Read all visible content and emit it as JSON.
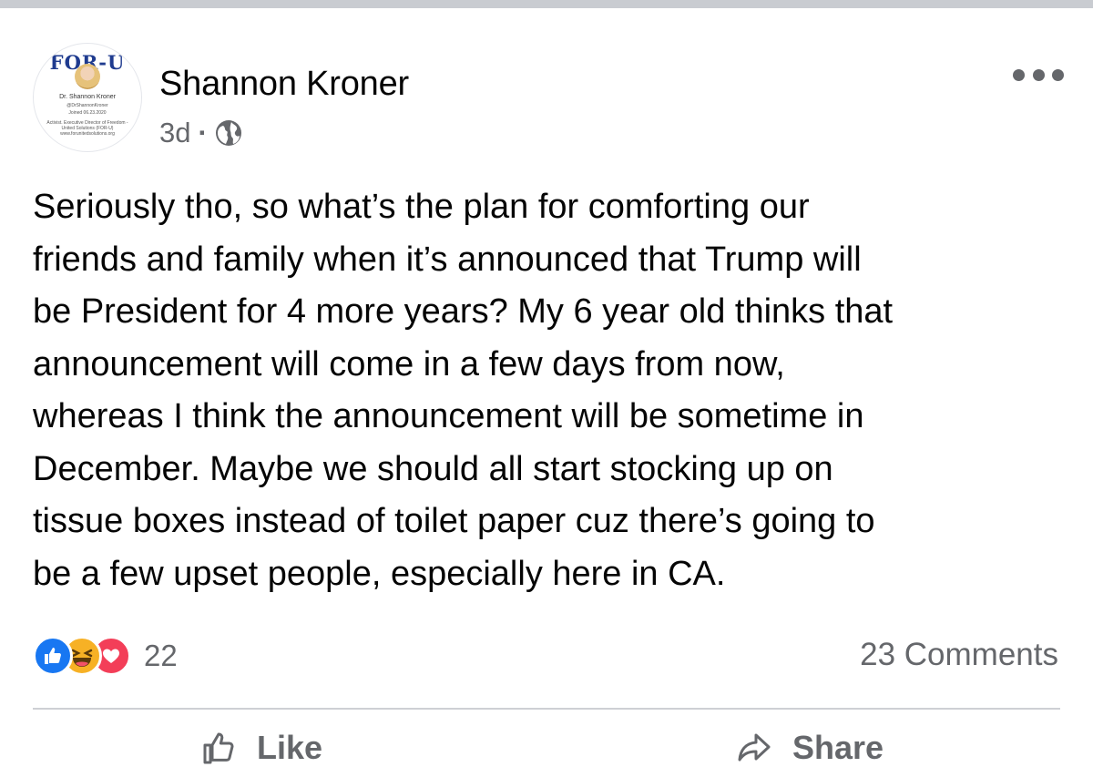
{
  "post": {
    "author": "Shannon Kroner",
    "time": "3d",
    "separator": "·",
    "privacy_icon": "globe-icon",
    "more_icon": "more-options-icon",
    "avatar": {
      "logo_text": "FOR-U",
      "name": "Dr. Shannon Kroner",
      "handle": "@DrShannonKroner",
      "joined": "Joined 06.23.2020",
      "bio": "Activist. Executive Director of Freedom - United Solutions (FOR-U) www.forunitedsolutions.org"
    },
    "text_lines": [
      "Seriously tho, so what’s the plan for comforting our",
      "friends and family when it’s announced that Trump will",
      "be President for 4 more years? My 6 year old thinks that",
      "announcement will come in a few days from now,",
      "whereas I think the announcement will be sometime in",
      "December. Maybe we should all start stocking up on",
      "tissue boxes instead of toilet paper cuz there’s going to",
      "be a few upset people, especially here in CA."
    ]
  },
  "reactions": {
    "types": [
      "like",
      "haha",
      "love"
    ],
    "count": "22"
  },
  "comments": {
    "label": "23 Comments"
  },
  "actions": {
    "like_label": "Like",
    "share_label": "Share"
  },
  "colors": {
    "like_blue": "#1877f2",
    "haha_yellow": "#f7b125",
    "love_red": "#f33e58",
    "secondary_text": "#65676b"
  }
}
